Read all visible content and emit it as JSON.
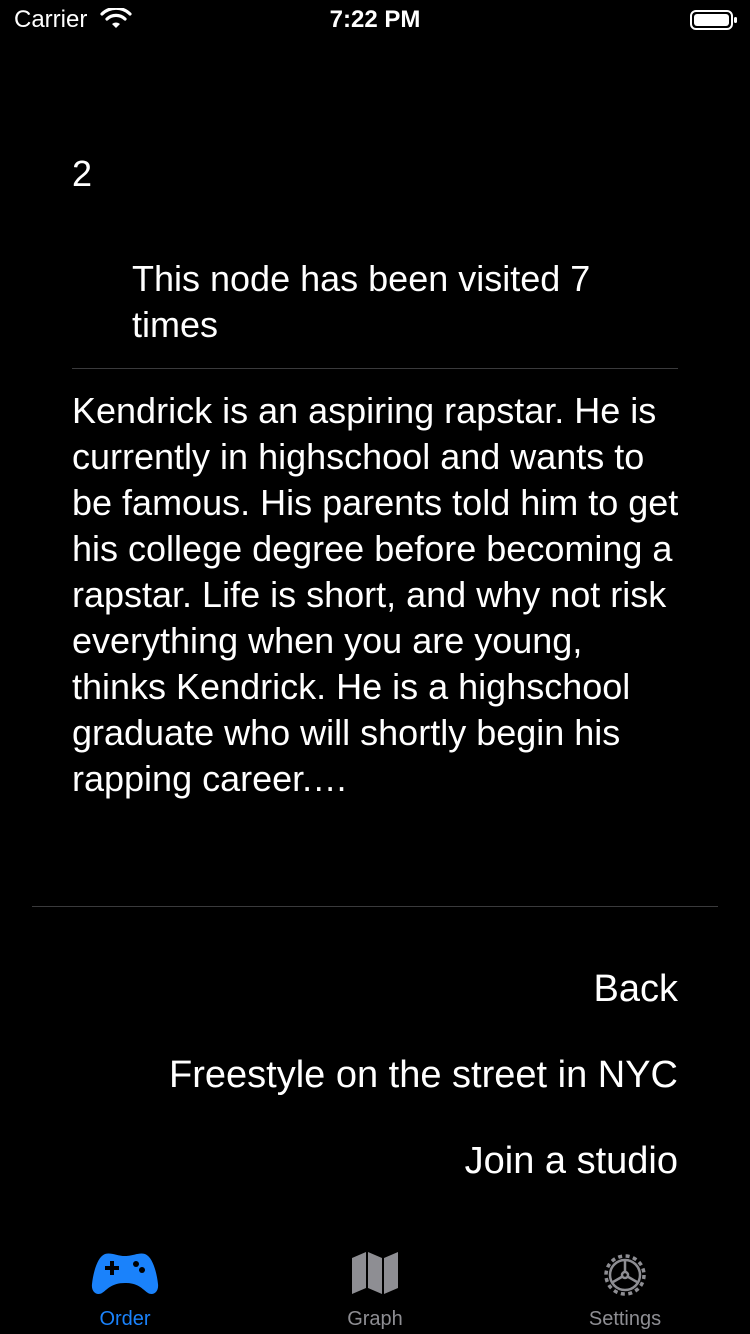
{
  "status_bar": {
    "carrier": "Carrier",
    "time": "7:22 PM"
  },
  "node": {
    "number": "2",
    "visited_text": "This node has been visited 7 times",
    "story": "Kendrick is an aspiring rapstar. He is currently in highschool and wants to be famous. His parents told him to get his college degree before becoming a rapstar. Life is short, and why not risk everything when you are young, thinks Kendrick. He is a highschool graduate who will shortly begin his rapping career.…"
  },
  "choices": [
    {
      "label": "Back"
    },
    {
      "label": "Freestyle on the street in NYC"
    },
    {
      "label": "Join a studio"
    }
  ],
  "tab_bar": {
    "tabs": [
      {
        "label": "Order",
        "icon": "gamecontroller-icon",
        "selected": true
      },
      {
        "label": "Graph",
        "icon": "map-icon",
        "selected": false
      },
      {
        "label": "Settings",
        "icon": "gear-icon",
        "selected": false
      }
    ],
    "active_color": "#1a82fb",
    "inactive_color": "#8e8e93"
  }
}
